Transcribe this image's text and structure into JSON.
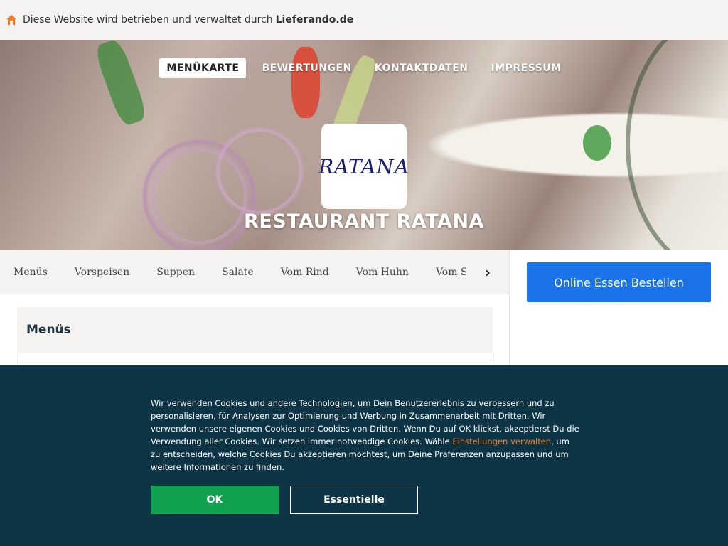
{
  "notice": {
    "prefix": "Diese Website wird betrieben und verwaltet durch",
    "brand": "Lieferando.de",
    "icon": "house-icon"
  },
  "nav": [
    {
      "label": "MENÜKARTE",
      "active": true
    },
    {
      "label": "BEWERTUNGEN",
      "active": false
    },
    {
      "label": "KONTAKTDATEN",
      "active": false
    },
    {
      "label": "IMPRESSUM",
      "active": false
    }
  ],
  "logo": {
    "text": "RATANA"
  },
  "restaurant": {
    "name": "RESTAURANT RATANA"
  },
  "categories": [
    "Menüs",
    "Vorspeisen",
    "Suppen",
    "Salate",
    "Vom Rind",
    "Vom Huhn",
    "Vom Sch"
  ],
  "order_button": "Online Essen Bestellen",
  "section": {
    "title": "Menüs"
  },
  "cookie": {
    "text_before": "Wir verwenden Cookies und andere Technologien, um Dein Benutzererlebnis zu verbessern und zu personalisieren, für Analysen zur Optimierung und Werbung in Zusammenarbeit mit Dritten. Wir verwenden unsere eigenen Cookies und Cookies von Dritten. Wenn Du auf OK klickst, akzeptierst Du die Verwendung aller Cookies. Wir setzen immer notwendige Cookies. Wähle ",
    "link": "Einstellungen verwalten",
    "text_after": ", um zu entscheiden, welche Cookies Du akzeptieren möchtest, um Deine Präferenzen anzupassen und um weitere Informationen zu finden.",
    "ok_label": "OK",
    "essential_label": "Essentielle"
  },
  "colors": {
    "accent_blue": "#1a73e8",
    "ok_green": "#12a150",
    "banner_bg": "#0d3546",
    "link_orange": "#f47b20"
  }
}
